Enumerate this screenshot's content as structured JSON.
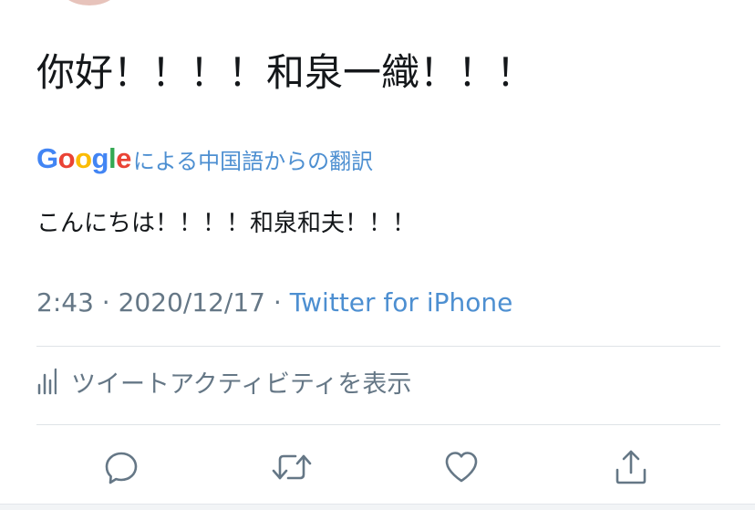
{
  "tweet": {
    "text": "你好！！！！和泉一織！！！"
  },
  "translation": {
    "google_logo": [
      "G",
      "o",
      "o",
      "g",
      "l",
      "e"
    ],
    "label": "による中国語からの翻訳",
    "text": "こんにちは！！！！和泉和夫！！！"
  },
  "meta": {
    "time": "2:43",
    "separator1": " · ",
    "date": "2020/12/17",
    "separator2": " · ",
    "source": "Twitter for iPhone"
  },
  "activity": {
    "icon": "bar-chart-icon",
    "label": "ツイートアクティビティを表示"
  },
  "actions": {
    "reply_icon": "reply-icon",
    "retweet_icon": "retweet-icon",
    "like_icon": "heart-icon",
    "share_icon": "share-icon"
  },
  "colors": {
    "link": "#4d8fd1",
    "muted": "#657786",
    "text": "#14171a",
    "google_blue": "#4285f4",
    "google_red": "#ea4335",
    "google_yellow": "#fbbc05",
    "google_green": "#34a853"
  }
}
